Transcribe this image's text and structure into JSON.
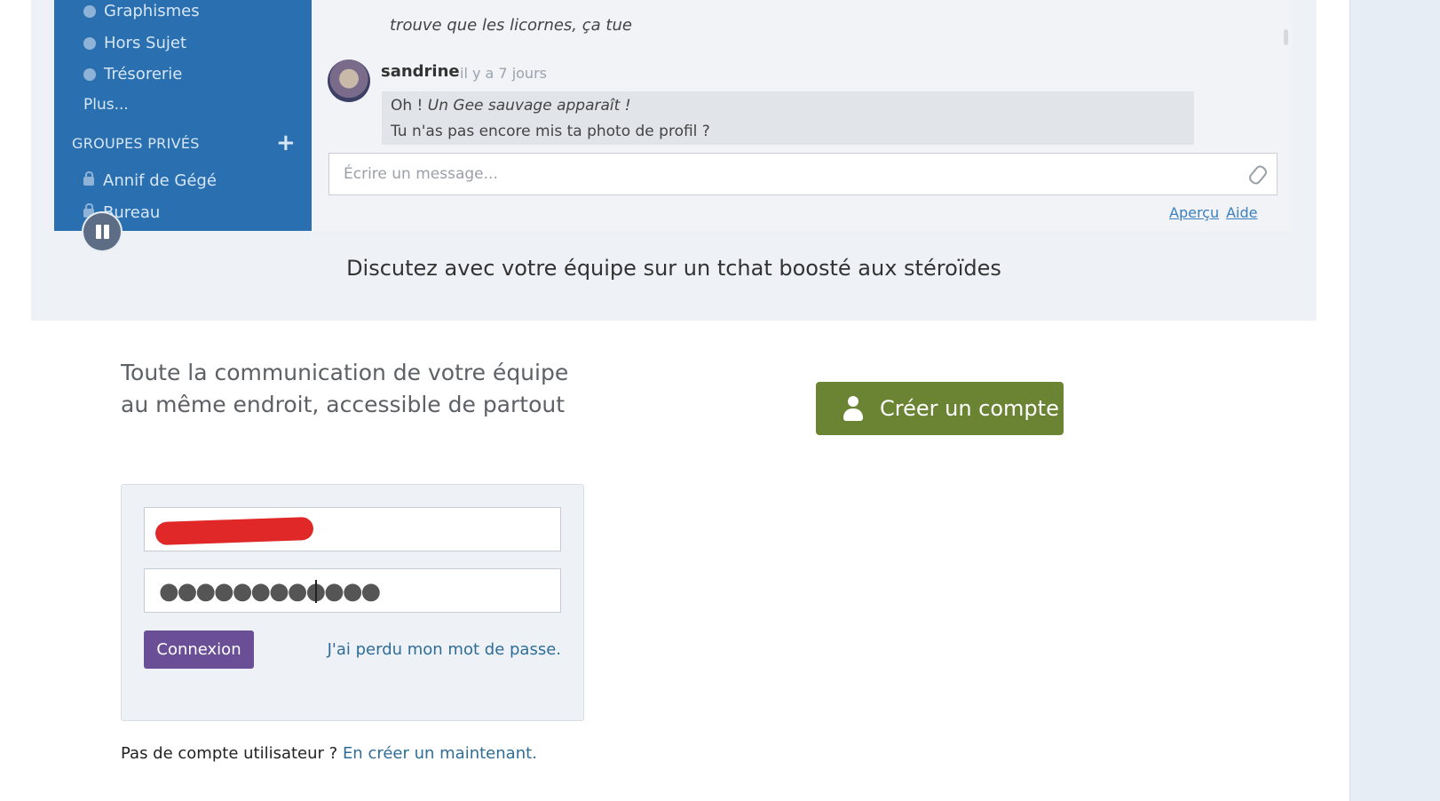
{
  "demo": {
    "sidebar": {
      "channels": [
        "Graphismes",
        "Hors Sujet",
        "Trésorerie"
      ],
      "more_label": "Plus...",
      "groups_title": "GROUPES PRIVÉS",
      "groups_plus": "+",
      "groups": [
        "Annif de Gégé",
        "Bureau"
      ]
    },
    "chat": {
      "previous_message": "trouve que les licornes, ça tue",
      "author": "sandrine",
      "time": "il y a 7 jours",
      "quote_prefix": "Oh ! ",
      "quote_italic": "Un Gee sauvage apparaît !",
      "quote_line2": "Tu n'as pas encore mis ta photo de profil ?",
      "input_placeholder": "Écrire un message...",
      "preview_link": "Aperçu",
      "help_link": "Aide"
    },
    "caption": "Discutez avec votre équipe sur un tchat boosté aux stéroïdes"
  },
  "tagline": "Toute la communication de votre équipe au même endroit, accessible de partout",
  "create_account_label": "Créer un compte",
  "login": {
    "password_mask": "●●●●●●●●●●●●",
    "submit_label": "Connexion",
    "forgot_link": "J'ai perdu mon mot de passe."
  },
  "signup_prompt": {
    "text": "Pas de compte utilisateur ? ",
    "link": "En créer un maintenant."
  },
  "colors": {
    "sidebar": "#2a70b0",
    "create_button": "#6b8433",
    "login_button": "#6a4f96",
    "link": "#2f6d96",
    "redaction": "#e02828"
  }
}
